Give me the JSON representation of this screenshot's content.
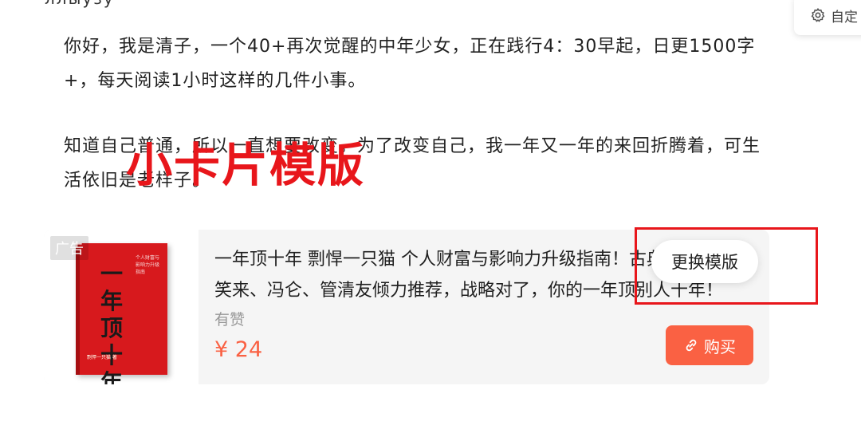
{
  "top_fragment": "ллыузу ···",
  "custom_button": {
    "label": "自定",
    "icon": "gear-icon"
  },
  "article": {
    "paragraph1": "你好，我是清子，一个40+再次觉醒的中年少女，正在践行4：30早起，日更1500字+，每天阅读1小时这样的几件小事。",
    "paragraph2": "知道自己普通，所以一直想要改变。为了改变自己，我一年又一年的来回折腾着，可生活依旧是老样子。"
  },
  "overlay_label": "小卡片模版",
  "card": {
    "ad_badge": "广告",
    "book_cover": {
      "title": "一年顶十年",
      "small_text": "个人财富与影响力升级指南",
      "bottom_text": "剽悍一只猫 著"
    },
    "title": "一年顶十年 剽悍一只猫 个人财富与影响力升级指南！古典、秋叶、李笑来、冯仑、管清友倾力推荐，战略对了，你的一年顶别人十年！",
    "author": "有赞",
    "price": "¥ 24",
    "buy_label": "购买",
    "buy_icon": "link-icon"
  },
  "replace_button": "更换模版",
  "colors": {
    "accent": "#fa6143",
    "annotation_red": "#e8161b",
    "card_bg": "#f5f5f5"
  }
}
